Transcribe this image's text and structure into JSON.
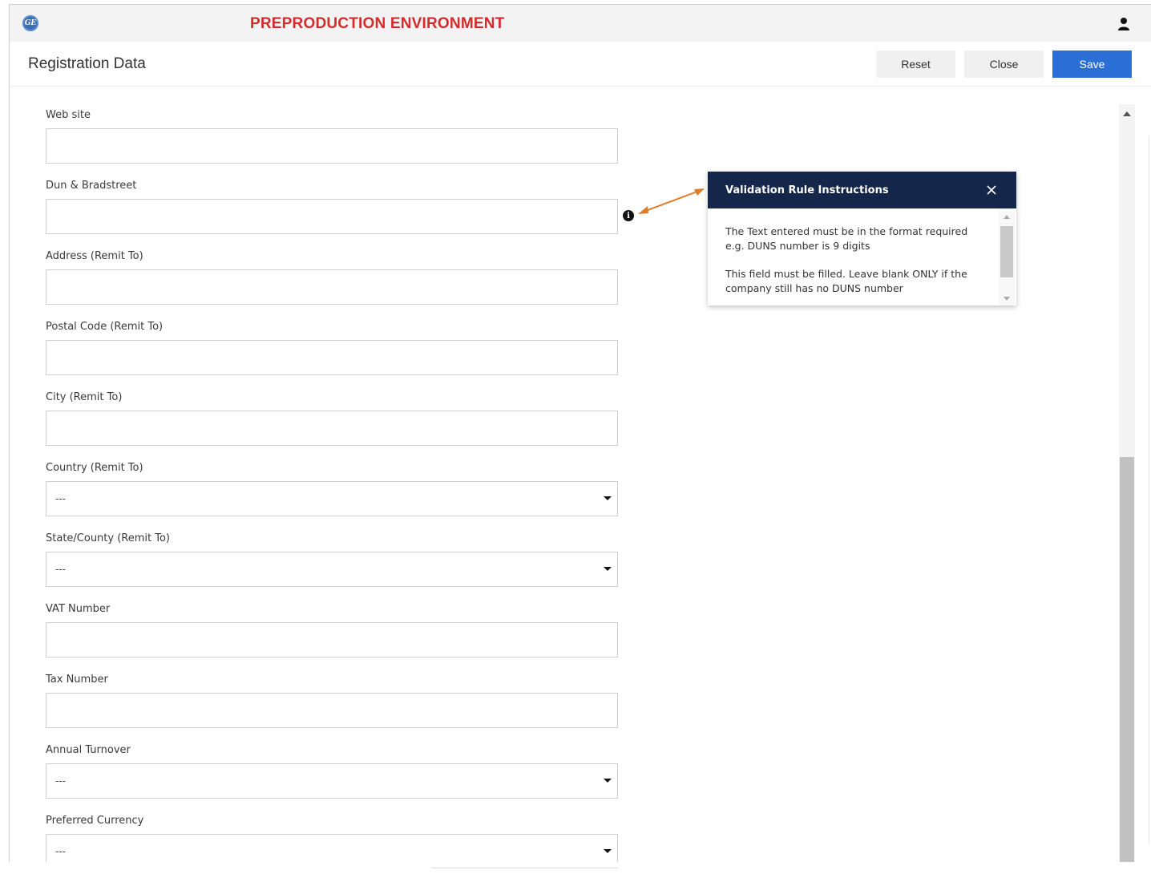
{
  "topbar": {
    "logo_text": "GE",
    "environment_label": "PREPRODUCTION ENVIRONMENT",
    "icons": {
      "logo": "ge-logo-icon",
      "user": "user-icon"
    },
    "env_color": "#d52b2b"
  },
  "header": {
    "title": "Registration Data",
    "buttons": {
      "reset": "Reset",
      "close": "Close",
      "save": "Save"
    },
    "save_color": "#2a6ed6"
  },
  "form": {
    "fields": [
      {
        "label": "Web site",
        "type": "text",
        "value": ""
      },
      {
        "label": "Dun & Bradstreet",
        "type": "text",
        "value": ""
      },
      {
        "label": "Address (Remit To)",
        "type": "text",
        "value": ""
      },
      {
        "label": "Postal Code (Remit To)",
        "type": "text",
        "value": ""
      },
      {
        "label": "City (Remit To)",
        "type": "text",
        "value": ""
      },
      {
        "label": "Country (Remit To)",
        "type": "select",
        "value": "---"
      },
      {
        "label": "State/County (Remit To)",
        "type": "select",
        "value": "---"
      },
      {
        "label": "VAT Number",
        "type": "text",
        "value": ""
      },
      {
        "label": "Tax Number",
        "type": "text",
        "value": ""
      },
      {
        "label": "Annual Turnover",
        "type": "select",
        "value": "---"
      },
      {
        "label": "Preferred Currency",
        "type": "select",
        "value": "---"
      }
    ]
  },
  "info": {
    "glyph": "i",
    "icon": "info-icon"
  },
  "popup": {
    "title": "Validation Rule Instructions",
    "lines": [
      "The Text entered must be in the format required e.g. DUNS number is 9 digits",
      "This field must be filled. Leave blank ONLY if the company still has no DUNS number"
    ],
    "header_color": "#14264a"
  },
  "annotation": {
    "arrow_color": "#e07b2a"
  }
}
